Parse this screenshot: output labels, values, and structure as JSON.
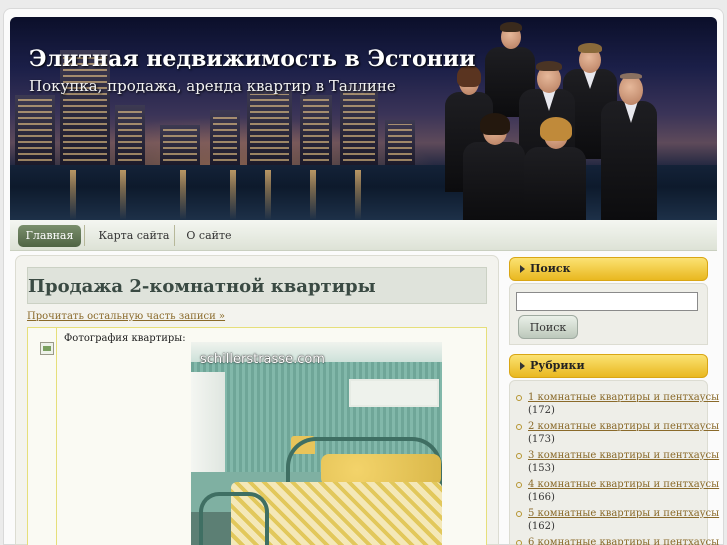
{
  "header": {
    "title": "Элитная недвижимость в Эстонии",
    "description": "Покупка, продажа, аренда квартир в Таллине"
  },
  "nav": {
    "items": [
      "Главная",
      "Карта сайта",
      "О сайте"
    ],
    "active": "Главная"
  },
  "post": {
    "title": "Продажа 2-комнатной квартиры",
    "read_more": "Прочитать остальную часть записи »",
    "photo_label": "Фотография квартиры:",
    "photo_watermark": "schillerstrasse.com"
  },
  "sidebar": {
    "search": {
      "heading": "Поиск",
      "input_value": "",
      "button_label": "Поиск"
    },
    "categories": {
      "heading": "Рубрики",
      "items": [
        {
          "label": "1 комнатные квартиры и пентхаусы",
          "count": "(172)"
        },
        {
          "label": "2 комнатные квартиры и пентхаусы",
          "count": "(173)"
        },
        {
          "label": "3 комнатные квартиры и пентхаусы",
          "count": "(153)"
        },
        {
          "label": "4 комнатные квартиры и пентхаусы",
          "count": "(166)"
        },
        {
          "label": "5 комнатные квартиры и пентхаусы",
          "count": "(162)"
        },
        {
          "label": "6 комнатные квартиры и пентхаусы",
          "count": ""
        }
      ]
    }
  },
  "colors": {
    "accent_yellow": "#e9b820",
    "nav_active": "#4f6444",
    "link": "#8a6a2a",
    "title_text": "#3a4a43"
  }
}
